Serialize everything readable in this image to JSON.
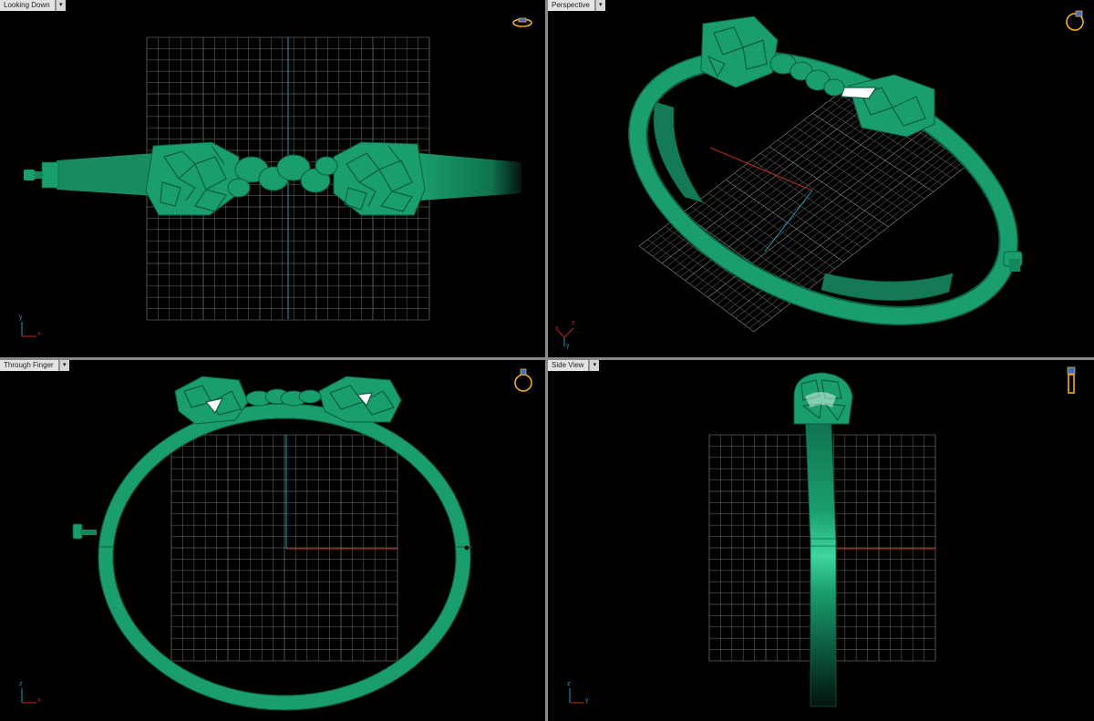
{
  "viewports": {
    "top_left": {
      "label": "Looking Down",
      "axis_labels": [
        "y",
        "x"
      ]
    },
    "top_right": {
      "label": "Perspective",
      "axis_labels": [
        "x",
        "z",
        "y"
      ]
    },
    "bottom_left": {
      "label": "Through Finger",
      "axis_labels": [
        "z",
        "x"
      ]
    },
    "bottom_right": {
      "label": "Side View",
      "axis_labels": [
        "z",
        "y"
      ]
    }
  },
  "menu_glyph": "▾",
  "colors": {
    "background": "#000000",
    "grid": "#7a7a7a",
    "model": "#1a9e6e",
    "model_dark": "#0b5f41",
    "axis_x": "#c0261f",
    "axis_y": "#1aa0b8",
    "view_icon": "#f0b020",
    "tab_bg": "#e4e4e4"
  },
  "icons": {
    "viewport_menu": "dropdown-arrow-icon",
    "view_orientation": "ring-view-icon",
    "axis": "axis-triad-icon"
  }
}
